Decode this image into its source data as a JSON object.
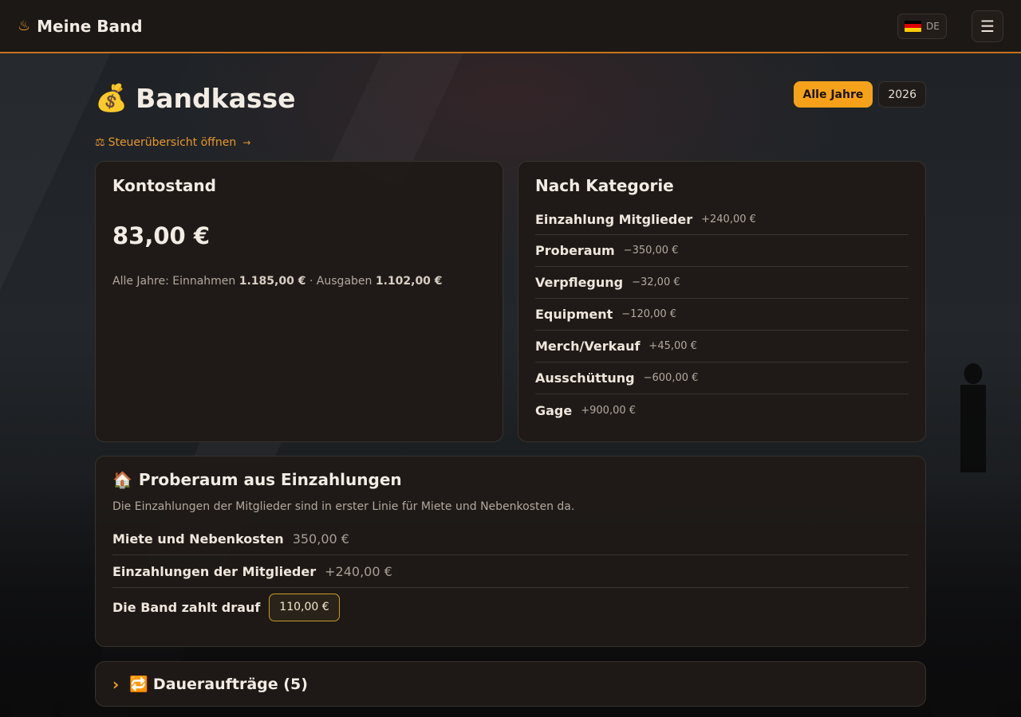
{
  "app": {
    "title": "Meine Band",
    "brand_icon": "flame-icon"
  },
  "header": {
    "language": {
      "code": "DE",
      "flag_colors": [
        "#000000",
        "#dd0000",
        "#ffce00"
      ]
    },
    "menu_icon": "hamburger-icon"
  },
  "page": {
    "title": "Bandkasse",
    "title_icon": "money-bag-icon",
    "tax_link": "Steuerübersicht öffnen",
    "year_filter": {
      "options": [
        "Alle Jahre",
        "2026"
      ],
      "selected": "Alle Jahre"
    }
  },
  "balance": {
    "heading": "Kontostand",
    "value": "83,00 €",
    "summary_prefix": "Alle Jahre: Einnahmen",
    "income": "1.185,00 €",
    "summary_mid": "· Ausgaben",
    "expenses": "1.102,00 €"
  },
  "categories": {
    "heading": "Nach Kategorie",
    "items": [
      {
        "name": "Einzahlung Mitglieder",
        "amount": "+240,00 €"
      },
      {
        "name": "Proberaum",
        "amount": "−350,00 €"
      },
      {
        "name": "Verpflegung",
        "amount": "−32,00 €"
      },
      {
        "name": "Equipment",
        "amount": "−120,00 €"
      },
      {
        "name": "Merch/Verkauf",
        "amount": "+45,00 €"
      },
      {
        "name": "Ausschüttung",
        "amount": "−600,00 €"
      },
      {
        "name": "Gage",
        "amount": "+900,00 €"
      }
    ]
  },
  "rehearsal": {
    "heading": "Proberaum aus Einzahlungen",
    "icon": "house-icon",
    "description": "Die Einzahlungen der Mitglieder sind in erster Linie für Miete und Nebenkosten da.",
    "rows": [
      {
        "label": "Miete und Nebenkosten",
        "value": "350,00 €"
      },
      {
        "label": "Einzahlungen der Mitglieder",
        "value": "+240,00 €"
      },
      {
        "label": "Die Band zahlt drauf",
        "value": "110,00 €"
      }
    ]
  },
  "standing_orders": {
    "heading": "Daueraufträge (5)",
    "icon": "repeat-icon"
  },
  "colors": {
    "accent": "#f5a21a",
    "background": "#1c1815"
  }
}
